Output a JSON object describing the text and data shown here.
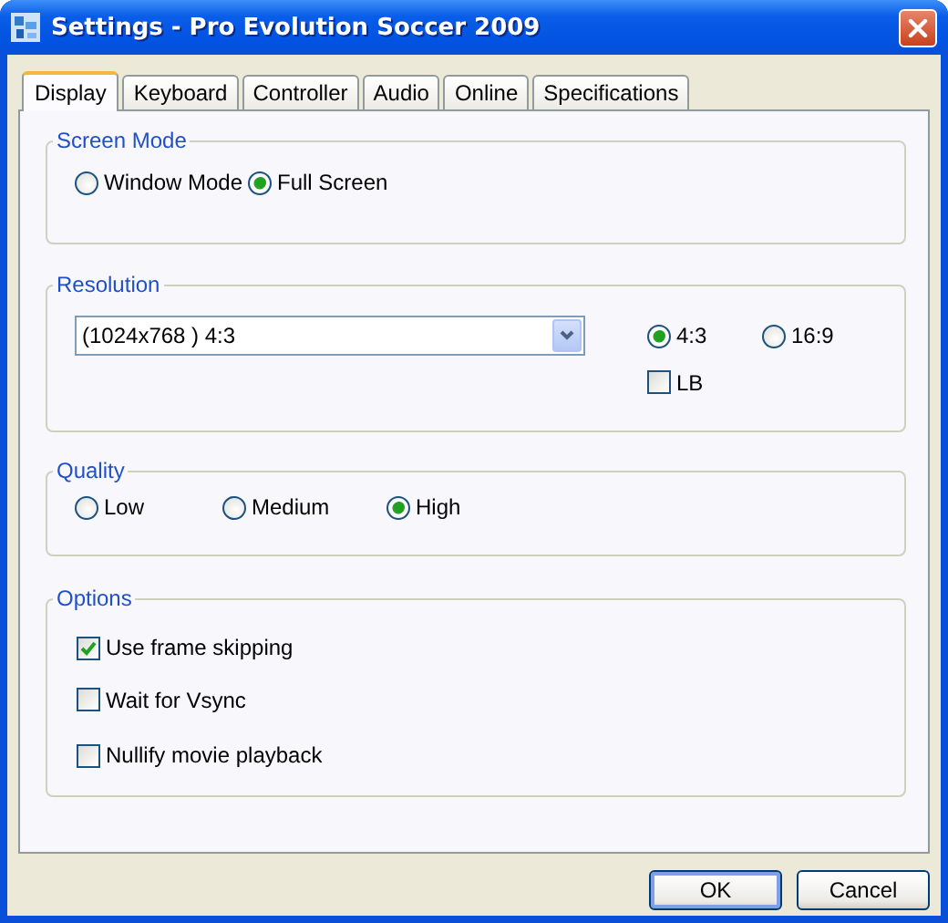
{
  "window": {
    "title": "Settings - Pro Evolution Soccer 2009"
  },
  "tabs": [
    {
      "label": "Display",
      "selected": true
    },
    {
      "label": "Keyboard",
      "selected": false
    },
    {
      "label": "Controller",
      "selected": false
    },
    {
      "label": "Audio",
      "selected": false
    },
    {
      "label": "Online",
      "selected": false
    },
    {
      "label": "Specifications",
      "selected": false
    }
  ],
  "screen_mode": {
    "title": "Screen Mode",
    "options": [
      {
        "label": "Window Mode",
        "selected": false
      },
      {
        "label": "Full Screen",
        "selected": true
      }
    ]
  },
  "resolution": {
    "title": "Resolution",
    "dropdown": {
      "value": "(1024x768 ) 4:3"
    },
    "aspect": [
      {
        "label": "4:3",
        "selected": true
      },
      {
        "label": "16:9",
        "selected": false
      }
    ],
    "letterbox": {
      "label": "LB",
      "checked": false
    }
  },
  "quality": {
    "title": "Quality",
    "options": [
      {
        "label": "Low",
        "selected": false
      },
      {
        "label": "Medium",
        "selected": false
      },
      {
        "label": "High",
        "selected": true
      }
    ]
  },
  "options": {
    "title": "Options",
    "items": [
      {
        "label": "Use frame skipping",
        "checked": true
      },
      {
        "label": "Wait for Vsync",
        "checked": false
      },
      {
        "label": "Nullify movie playback",
        "checked": false
      }
    ]
  },
  "buttons": [
    {
      "label": "OK",
      "kind": "default"
    },
    {
      "label": "Cancel",
      "kind": "normal"
    }
  ]
}
